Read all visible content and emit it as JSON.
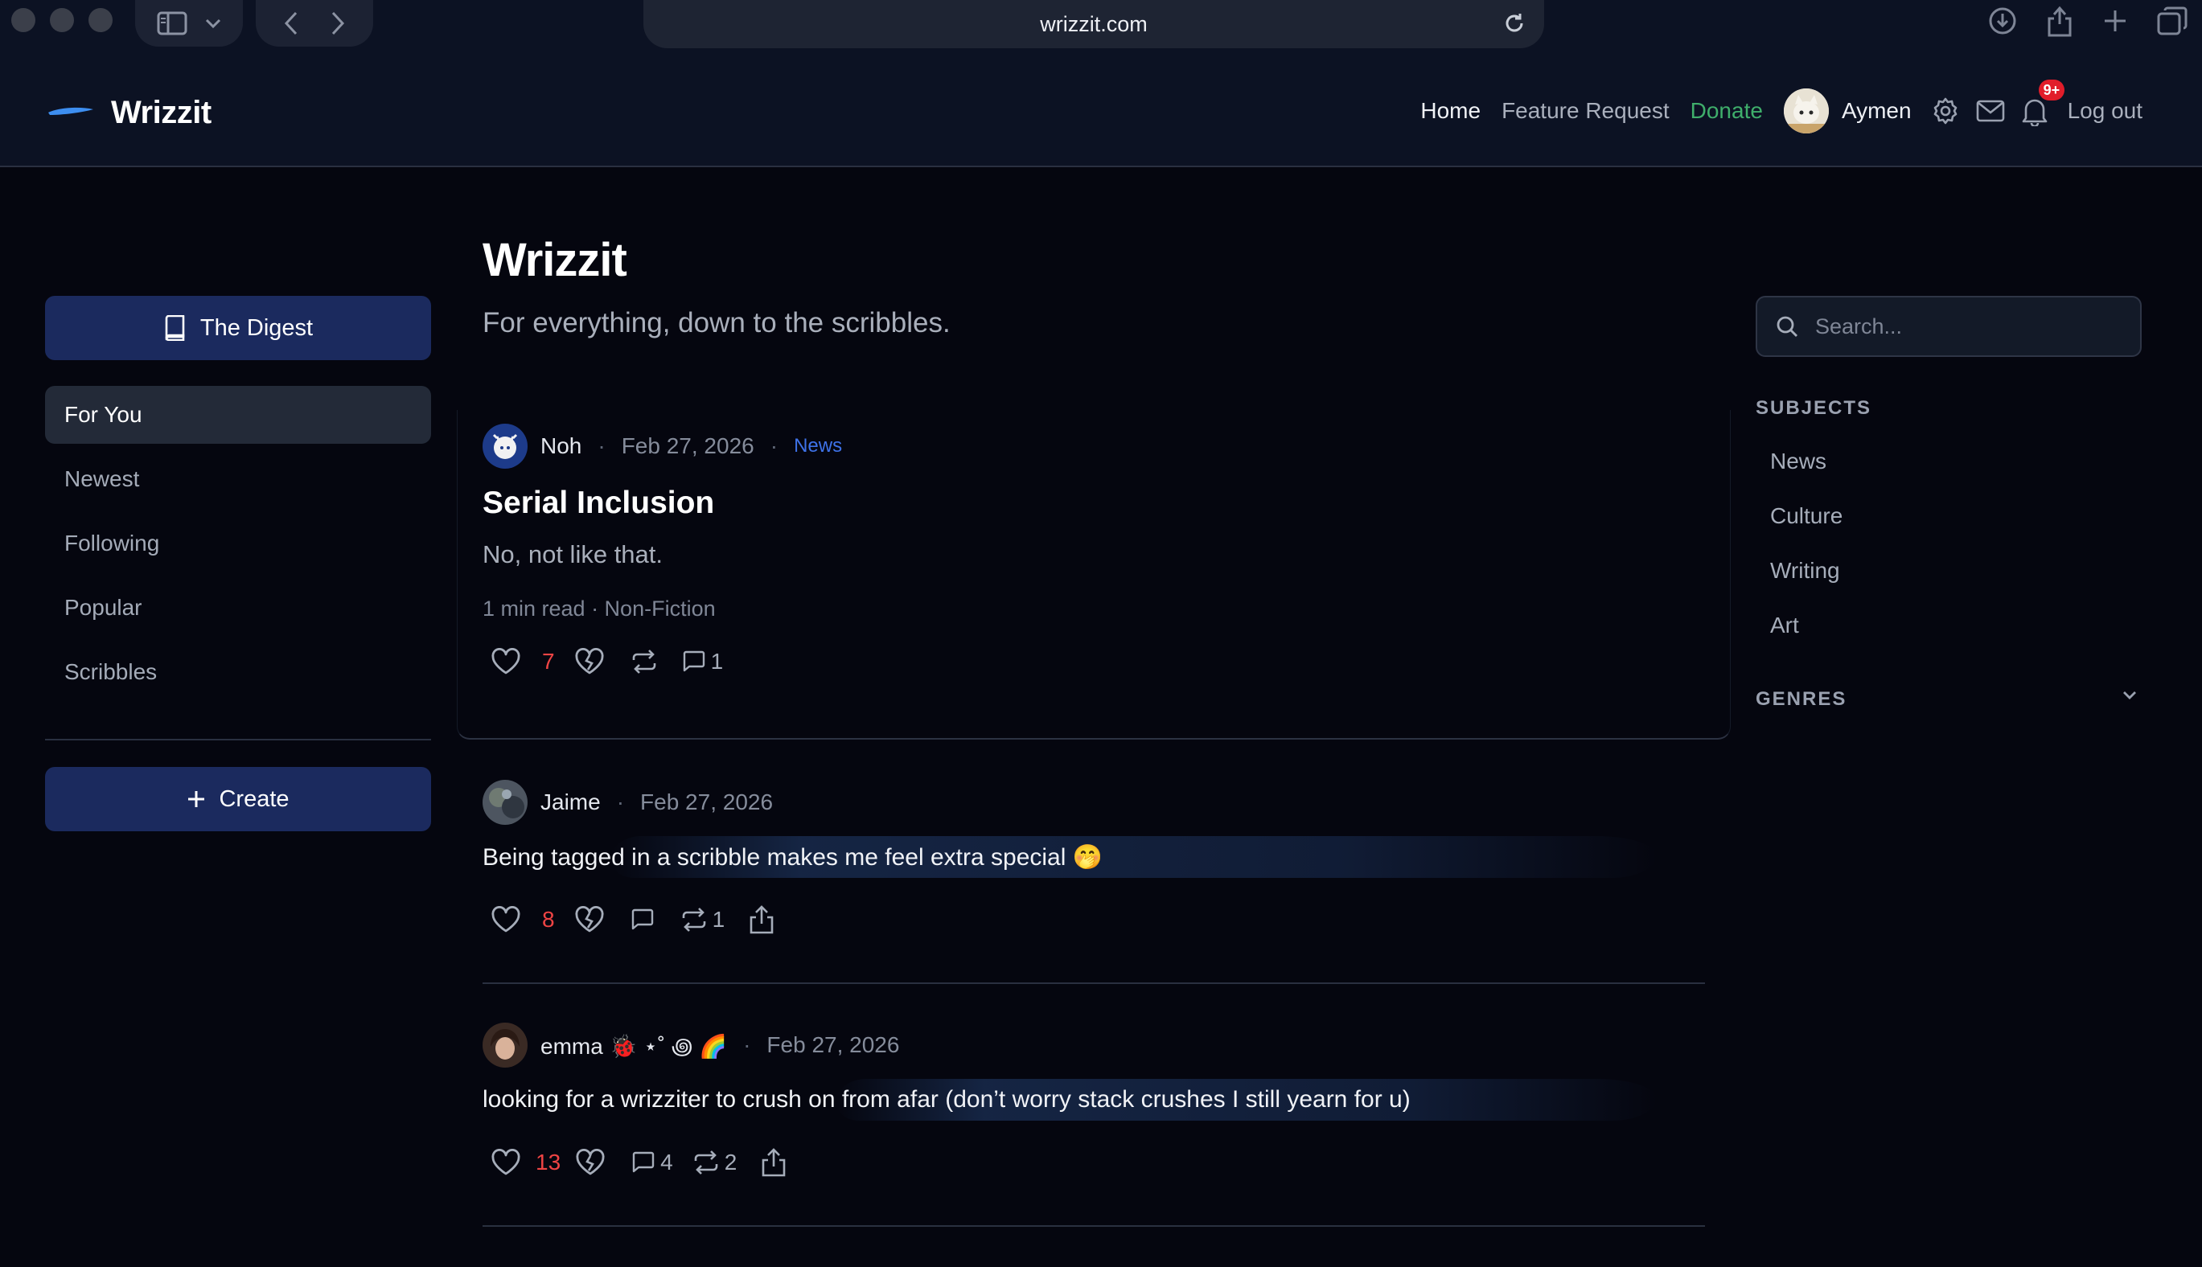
{
  "browser": {
    "url": "wrizzit.com"
  },
  "header": {
    "brand": "Wrizzit",
    "nav": {
      "home": "Home",
      "feature_request": "Feature Request",
      "donate": "Donate",
      "username": "Aymen",
      "notifications_badge": "9+",
      "logout": "Log out"
    },
    "colors": {
      "donate": "#3fae6b",
      "badge": "#e11d2a",
      "accent": "#1b2a5e"
    }
  },
  "sidebar": {
    "digest_label": "The Digest",
    "items": [
      {
        "label": "For You",
        "active": true
      },
      {
        "label": "Newest",
        "active": false
      },
      {
        "label": "Following",
        "active": false
      },
      {
        "label": "Popular",
        "active": false
      },
      {
        "label": "Scribbles",
        "active": false
      }
    ],
    "create_label": "Create"
  },
  "main": {
    "title": "Wrizzit",
    "subtitle": "For everything, down to the scribbles.",
    "posts": [
      {
        "author": "Noh",
        "date": "Feb 27, 2026",
        "tag": "News",
        "title": "Serial Inclusion",
        "subtitle": "No, not like that.",
        "info": "1 min read · Non-Fiction",
        "likes": "7",
        "comments": "1"
      },
      {
        "author": "Jaime",
        "date": "Feb 27, 2026",
        "text": "Being tagged in a scribble makes me feel extra special 🤭",
        "likes": "8",
        "reposts": "1"
      },
      {
        "author": "emma 🐞 ⋆˚ ꩜ 🌈",
        "date": "Feb 27, 2026",
        "text": "looking for a wrizziter to crush on from afar (don’t worry stack crushes I still yearn for u)",
        "likes": "13",
        "comments": "4",
        "reposts": "2"
      }
    ]
  },
  "right": {
    "search_placeholder": "Search...",
    "subjects_title": "SUBJECTS",
    "subjects": [
      "News",
      "Culture",
      "Writing",
      "Art"
    ],
    "genres_title": "GENRES"
  }
}
